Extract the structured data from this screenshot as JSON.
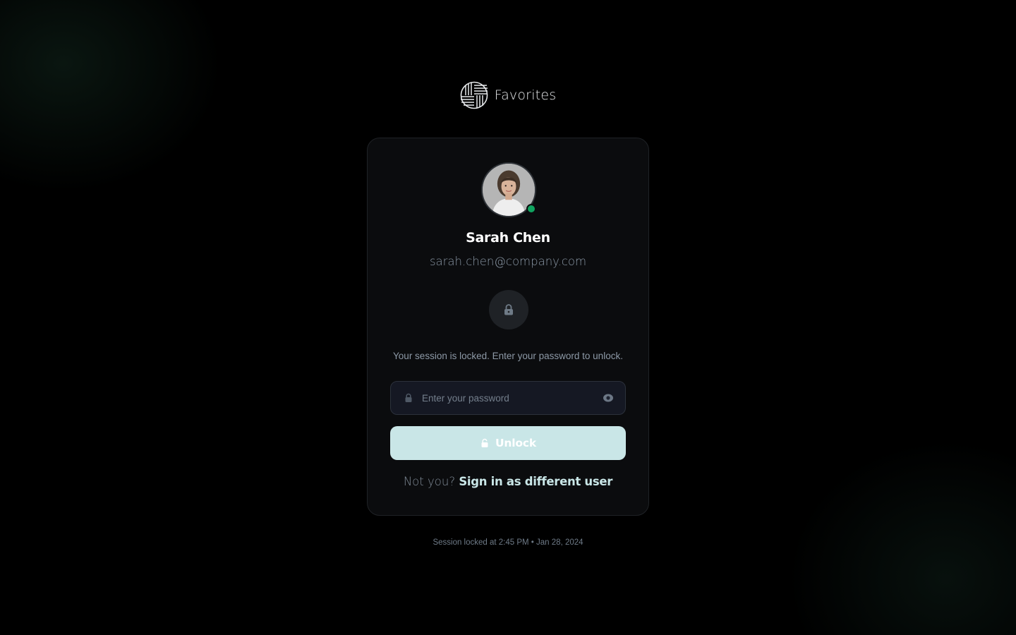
{
  "brand": {
    "name": "Favorites",
    "icon": "woven-grid-logo-icon"
  },
  "user": {
    "name": "Sarah Chen",
    "email": "sarah.chen@company.com",
    "status": "online",
    "status_color": "#10a35f"
  },
  "lock_icon": "padlock-icon",
  "session": {
    "message": "Your session is locked. Enter your password to unlock."
  },
  "password": {
    "placeholder": "Enter your password",
    "value": ""
  },
  "unlock": {
    "label": "Unlock",
    "background": "#c9e6e7"
  },
  "switch_user": {
    "prompt": "Not you?",
    "link_label": "Sign in as different user"
  },
  "footer": {
    "locked_at": "Session locked at 2:45 PM • Jan 28, 2024"
  },
  "colors": {
    "accent": "#c9e6e7",
    "card": "#0b0c0e",
    "page": "#000000"
  }
}
